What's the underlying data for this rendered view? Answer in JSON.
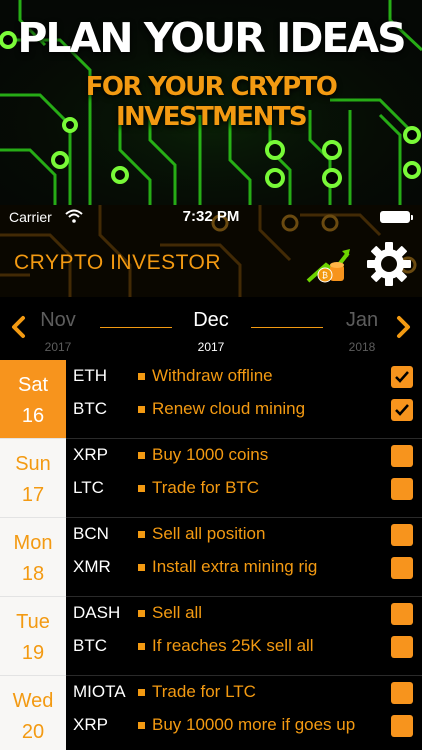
{
  "promo": {
    "title": "PLAN YOUR IDEAS",
    "subtitle": "FOR YOUR CRYPTO INVESTMENTS"
  },
  "status_bar": {
    "carrier": "Carrier",
    "time": "7:32 PM"
  },
  "header": {
    "title": "CRYPTO INVESTOR",
    "icons": [
      "coins-growth-icon",
      "gear-icon"
    ]
  },
  "month_nav": {
    "prev": {
      "month": "Nov",
      "year": "2017"
    },
    "current": {
      "month": "Dec",
      "year": "2017"
    },
    "next": {
      "month": "Jan",
      "year": "2018"
    }
  },
  "days": [
    {
      "dow": "Sat",
      "day": "16",
      "active": true,
      "tasks": [
        {
          "coin": "ETH",
          "text": "Withdraw offline",
          "done": true
        },
        {
          "coin": "BTC",
          "text": "Renew cloud mining",
          "done": true
        }
      ]
    },
    {
      "dow": "Sun",
      "day": "17",
      "active": false,
      "tasks": [
        {
          "coin": "XRP",
          "text": "Buy 1000 coins",
          "done": false
        },
        {
          "coin": "LTC",
          "text": "Trade for BTC",
          "done": false
        }
      ]
    },
    {
      "dow": "Mon",
      "day": "18",
      "active": false,
      "tasks": [
        {
          "coin": "BCN",
          "text": "Sell all position",
          "done": false
        },
        {
          "coin": "XMR",
          "text": "Install extra mining rig",
          "done": false
        }
      ]
    },
    {
      "dow": "Tue",
      "day": "19",
      "active": false,
      "tasks": [
        {
          "coin": "DASH",
          "text": "Sell all",
          "done": false
        },
        {
          "coin": "BTC",
          "text": "If reaches 25K sell all",
          "done": false
        }
      ]
    },
    {
      "dow": "Wed",
      "day": "20",
      "active": false,
      "tasks": [
        {
          "coin": "MIOTA",
          "text": "Trade for LTC",
          "done": false
        },
        {
          "coin": "XRP",
          "text": "Buy 10000 more if goes up",
          "done": false
        }
      ]
    }
  ],
  "colors": {
    "accent": "#f39a12",
    "checkbox": "#f7941d",
    "circuit_glow": "#39ff14"
  }
}
